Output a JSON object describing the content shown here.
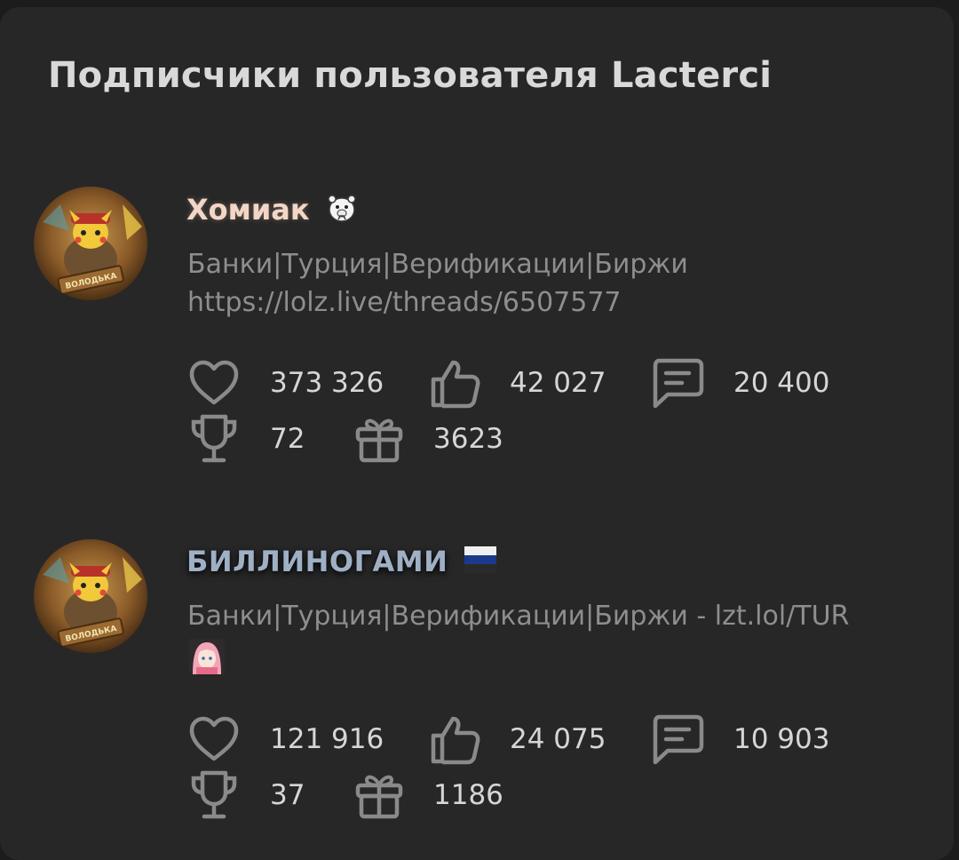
{
  "page": {
    "title": "Подписчики пользователя Lacterci"
  },
  "users": [
    {
      "name": "Хомиак",
      "name_color": "#f2d6c8",
      "badge_icon": "hamster-icon",
      "avatar_icon": "pikachu-avatar",
      "avatar_label": "ВОЛОДЬКА",
      "status_line1": "Банки|Турция|Верификации|Биржи",
      "status_line2": "https://lolz.live/threads/6507577",
      "stats": {
        "likes": "373 326",
        "thumbs": "42 027",
        "messages": "20 400",
        "trophies": "72",
        "gifts": "3623"
      }
    },
    {
      "name": "БИЛЛИНОГАМИ",
      "name_color": "#9fb0c4",
      "badge_icon": "russia-flag-icon",
      "avatar_icon": "pikachu-avatar",
      "avatar_label": "ВОЛОДЬКА",
      "status_line1": "Банки|Турция|Верификации|Биржи - lzt.lol/TUR",
      "status_icon": "anime-girl-icon",
      "stats": {
        "likes": "121 916",
        "thumbs": "24 075",
        "messages": "10 903",
        "trophies": "37",
        "gifts": "1186"
      }
    }
  ]
}
